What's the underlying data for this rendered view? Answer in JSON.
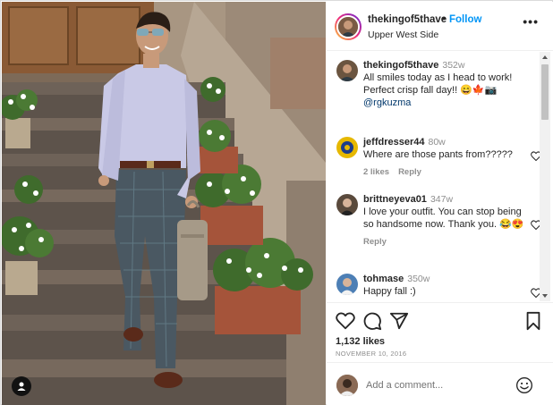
{
  "post": {
    "username": "thekingof5thave",
    "follow_label": "Follow",
    "separator": "•",
    "location": "Upper West Side",
    "more_icon": "more-horizontal-icon"
  },
  "comments": [
    {
      "username": "thekingof5thave",
      "time": "352w",
      "text": "All smiles today as I head to work! Perfect crisp fall day!! 😄🍁📷",
      "mention": "@rgkuzma",
      "avatar_color": "#6b5540"
    },
    {
      "username": "jeffdresser44",
      "time": "80w",
      "text": "Where are those pants from?????",
      "likes": "2 likes",
      "reply": "Reply",
      "avatar_color": "#e6b800"
    },
    {
      "username": "brittneyeva01",
      "time": "347w",
      "text": "I love your outfit. You can stop being so handsome now. Thank you. 😂😍",
      "reply": "Reply",
      "avatar_color": "#5a4a3c"
    },
    {
      "username": "tohmase",
      "time": "350w",
      "text": "Happy fall :)",
      "avatar_color": "#4d7fb5"
    }
  ],
  "stats": {
    "likes": "1,132 likes",
    "date": "NOVEMBER 10, 2016"
  },
  "add_comment": {
    "placeholder": "Add a comment..."
  },
  "icons": {
    "like": "heart-icon",
    "comment": "comment-icon",
    "share": "send-icon",
    "save": "bookmark-icon",
    "emoji": "emoji-icon",
    "user_tag": "user-tag-icon"
  },
  "colors": {
    "link": "#0095f6",
    "mention": "#00376b",
    "muted": "#8e8e8e",
    "text": "#262626"
  }
}
